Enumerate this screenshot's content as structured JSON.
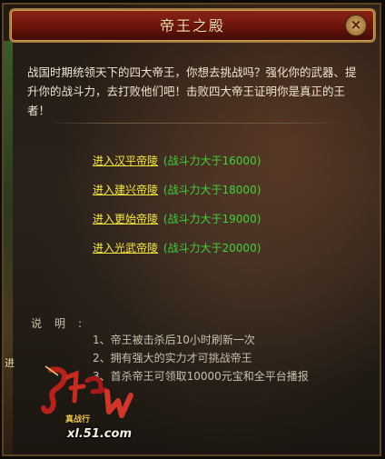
{
  "window": {
    "title": "帝王之殿",
    "close_glyph": "×"
  },
  "intro": "战国时期统领天下的四大帝王，你想去挑战吗？强化你的武器、提升你的战斗力，去打败他们吧！击败四大帝王证明你是真正的王者！",
  "entries": [
    {
      "link": "进入汉平帝陵",
      "requirement": "(战斗力大于16000)"
    },
    {
      "link": "进入建兴帝陵",
      "requirement": "(战斗力大于18000)"
    },
    {
      "link": "进入更始帝陵",
      "requirement": "(战斗力大于19000)"
    },
    {
      "link": "进入光武帝陵",
      "requirement": "(战斗力大于20000)"
    }
  ],
  "notes": {
    "label": "说明:",
    "items": [
      "1、帝王被击杀后10小时刷新一次",
      "2、拥有强大的实力才可挑战帝王",
      "3、首杀帝王可领取10000元宝和全平台播报"
    ]
  },
  "side_mark": "进",
  "logo": {
    "subtitle": "真战行",
    "url": "xl.51.com"
  },
  "colors": {
    "title_bar": "#6a150c",
    "link": "#f4ea3d",
    "requirement": "#3fd13a",
    "body_text": "#efe6d2"
  }
}
